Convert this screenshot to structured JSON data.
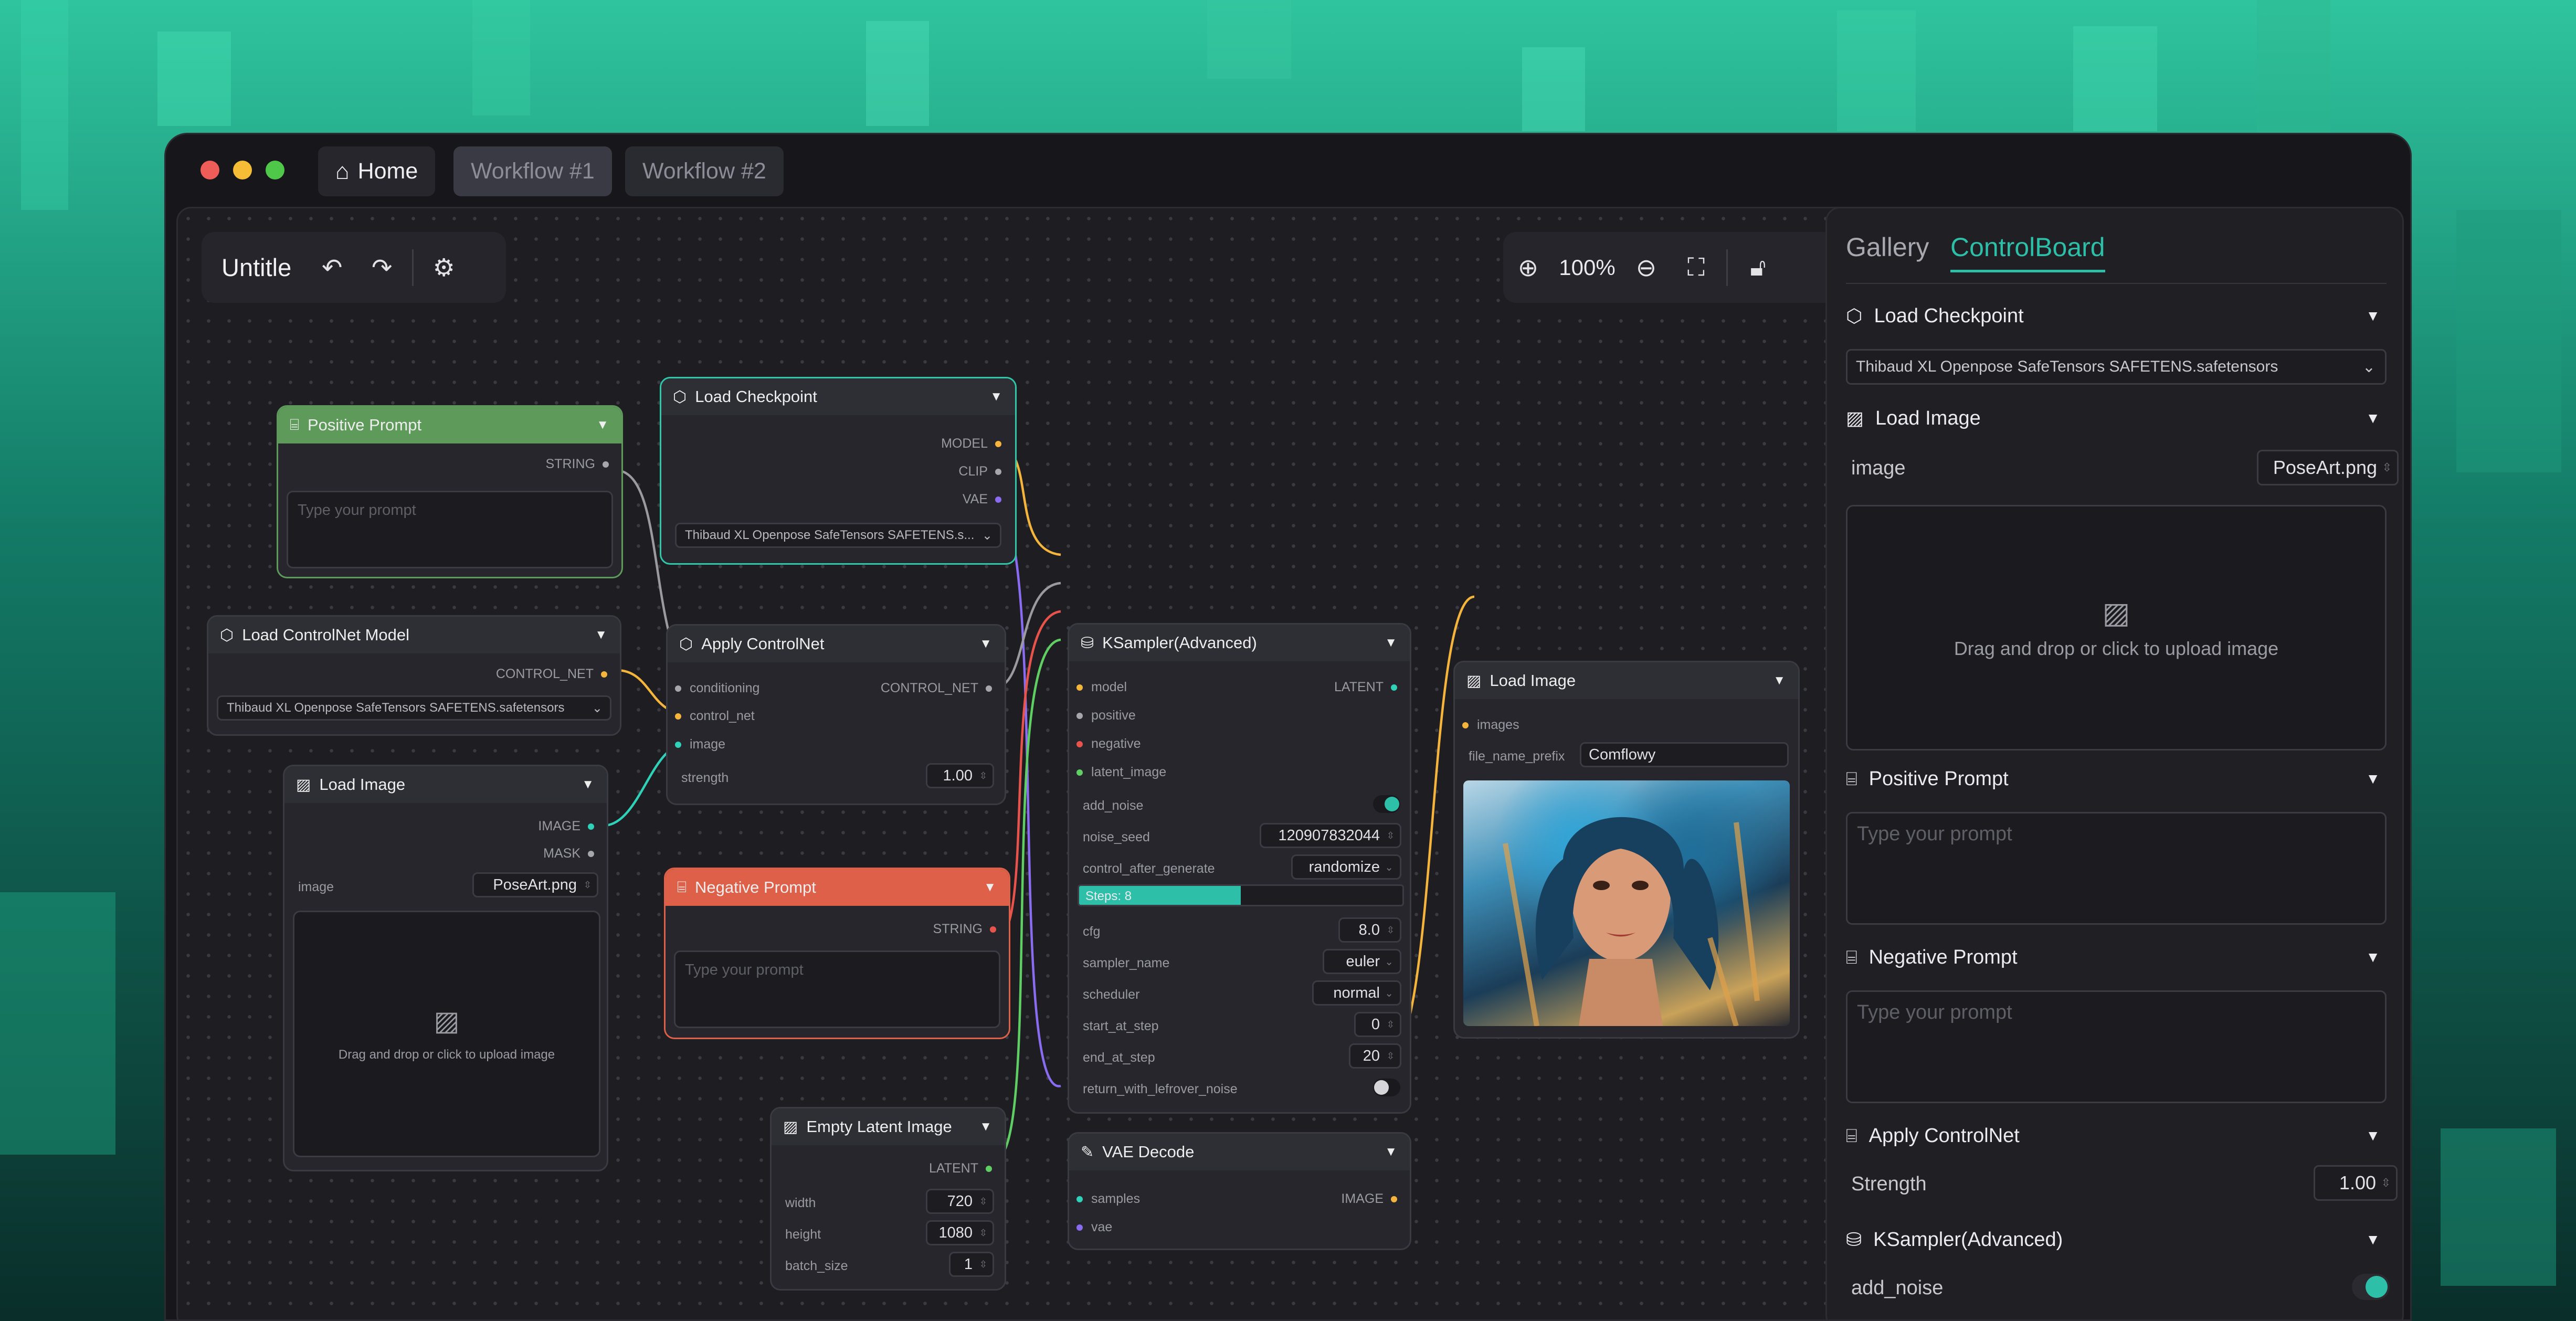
{
  "window": {
    "tabs": {
      "home": "Home",
      "wf1": "Workflow #1",
      "wf2": "Workflow #2"
    }
  },
  "toolbar": {
    "title": "Untitle",
    "zoom": "100%"
  },
  "nodes": {
    "positive_prompt": {
      "title": "Positive Prompt",
      "output": "STRING",
      "placeholder": "Type your prompt"
    },
    "load_checkpoint": {
      "title": "Load Checkpoint",
      "outputs": [
        "MODEL",
        "CLIP",
        "VAE"
      ],
      "model": "Thibaud XL Openpose SafeTensors SAFETENS.s..."
    },
    "load_controlnet": {
      "title": "Load ControlNet Model",
      "output": "CONTROL_NET",
      "model": "Thibaud XL Openpose SafeTensors SAFETENS.safetensors"
    },
    "apply_controlnet": {
      "title": "Apply ControlNet",
      "inputs": [
        "conditioning",
        "control_net",
        "image"
      ],
      "output": "CONTROL_NET",
      "strength_label": "strength",
      "strength": "1.00"
    },
    "load_image": {
      "title": "Load Image",
      "outputs": [
        "IMAGE",
        "MASK"
      ],
      "image_label": "image",
      "image": "PoseArt.png",
      "drop_text": "Drag and drop or click to upload image"
    },
    "negative_prompt": {
      "title": "Negative Prompt",
      "output": "STRING",
      "placeholder": "Type your prompt"
    },
    "empty_latent": {
      "title": "Empty Latent Image",
      "output": "LATENT",
      "width_label": "width",
      "width": "720",
      "height_label": "height",
      "height": "1080",
      "batch_label": "batch_size",
      "batch": "1"
    },
    "ksampler": {
      "title": "KSampler(Advanced)",
      "inputs": [
        "model",
        "positive",
        "negative",
        "latent_image"
      ],
      "output": "LATENT",
      "add_noise": "add_noise",
      "noise_seed_label": "noise_seed",
      "noise_seed": "120907832044",
      "control_label": "control_after_generate",
      "control": "randomize",
      "steps": "Steps: 8",
      "steps_fraction": 0.5,
      "cfg_label": "cfg",
      "cfg": "8.0",
      "sampler_label": "sampler_name",
      "sampler": "euler",
      "scheduler_label": "scheduler",
      "scheduler": "normal",
      "start_label": "start_at_step",
      "start": "0",
      "end_label": "end_at_step",
      "end": "20",
      "leftover_label": "return_with_lefrover_noise"
    },
    "vae_decode": {
      "title": "VAE Decode",
      "inputs": [
        "samples",
        "vae"
      ],
      "output": "IMAGE"
    },
    "save_image": {
      "title": "Load Image",
      "input": "images",
      "prefix_label": "file_name_prefix",
      "prefix": "Comflowy"
    }
  },
  "panel": {
    "tabs": {
      "gallery": "Gallery",
      "controlboard": "ControlBoard"
    },
    "checkpoint": {
      "title": "Load Checkpoint",
      "value": "Thibaud XL Openpose SafeTensors SAFETENS.safetensors"
    },
    "load_image": {
      "title": "Load Image",
      "label": "image",
      "value": "PoseArt.png",
      "drop_text": "Drag and drop or click to upload image"
    },
    "positive": {
      "title": "Positive Prompt",
      "placeholder": "Type your prompt"
    },
    "negative": {
      "title": "Negative Prompt",
      "placeholder": "Type your prompt"
    },
    "apply": {
      "title": "Apply ControlNet",
      "label": "Strength",
      "value": "1.00"
    },
    "ksampler": {
      "title": "KSampler(Advanced)",
      "label": "add_noise"
    }
  },
  "colors": {
    "accent": "#2dbfa8",
    "positive": "#5e9a5a",
    "negative": "#de6048",
    "checkpoint_border": "#2fc7a8"
  }
}
